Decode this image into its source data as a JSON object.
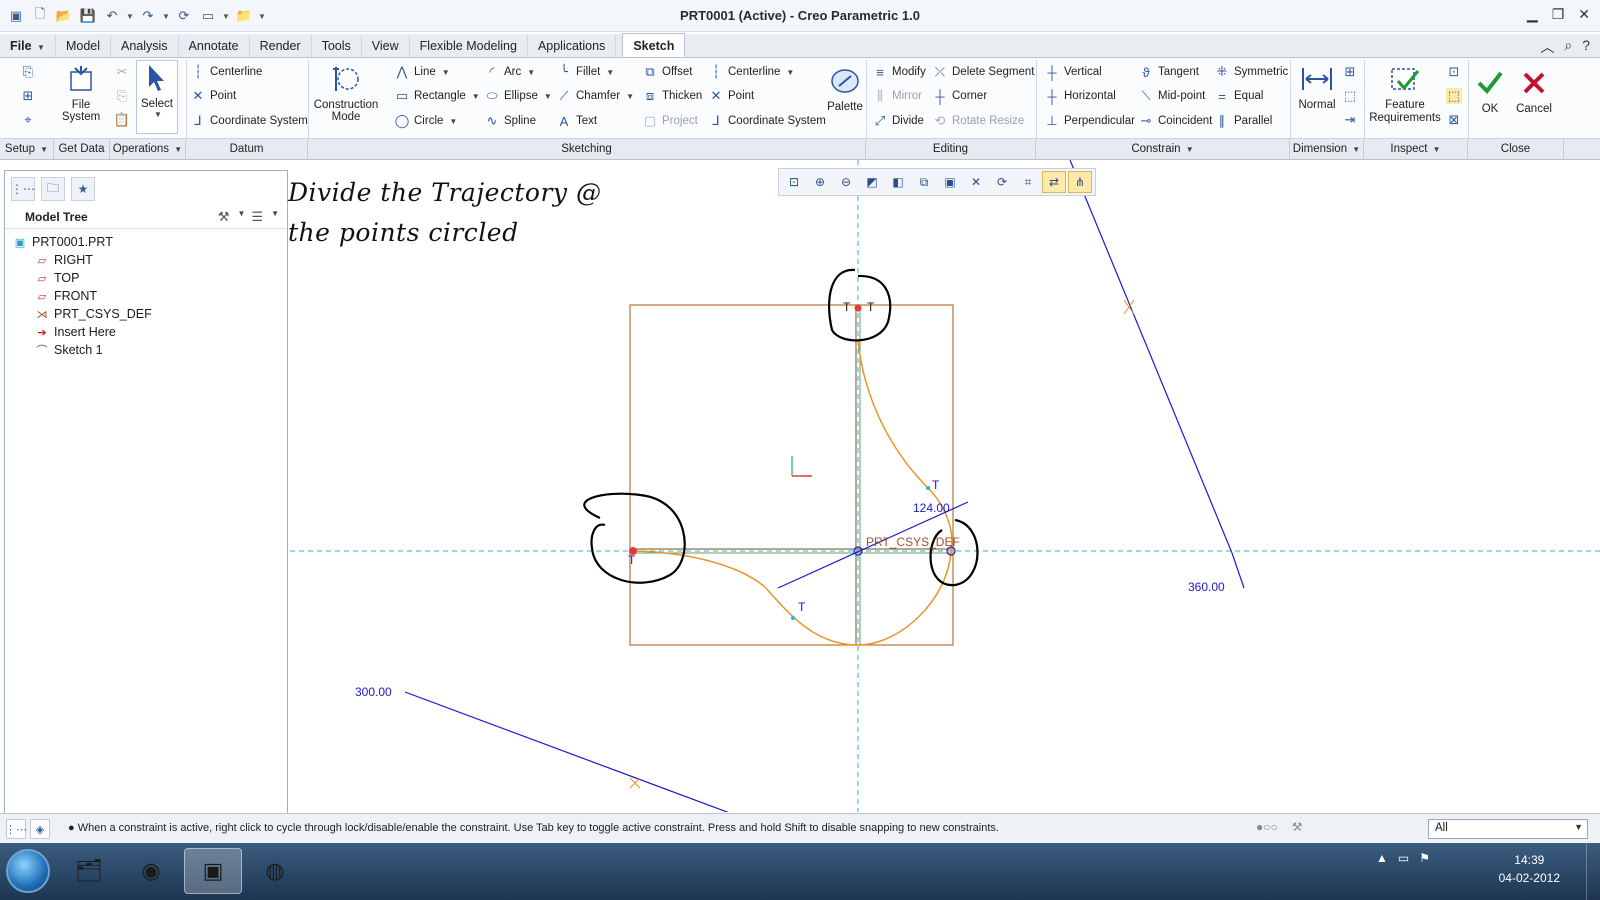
{
  "window": {
    "title": "PRT0001 (Active) - Creo Parametric 1.0"
  },
  "tabs": [
    {
      "label": "File"
    },
    {
      "label": "Model"
    },
    {
      "label": "Analysis"
    },
    {
      "label": "Annotate"
    },
    {
      "label": "Render"
    },
    {
      "label": "Tools"
    },
    {
      "label": "View"
    },
    {
      "label": "Flexible Modeling"
    },
    {
      "label": "Applications"
    },
    {
      "label": "Sketch",
      "active": true
    }
  ],
  "ribbon": {
    "setup": {
      "file_system": "File\nSystem",
      "select": "Select"
    },
    "datum": {
      "centerline": "Centerline",
      "point": "Point",
      "coordinate_system": "Coordinate System"
    },
    "construction_mode": "Construction\nMode",
    "sketching": {
      "line": "Line",
      "rectangle": "Rectangle",
      "circle": "Circle",
      "arc": "Arc",
      "ellipse": "Ellipse",
      "spline": "Spline",
      "fillet": "Fillet",
      "chamfer": "Chamfer",
      "text": "Text",
      "offset": "Offset",
      "thicken": "Thicken",
      "project": "Project",
      "centerline": "Centerline",
      "point": "Point",
      "coordinate_system": "Coordinate System",
      "palette": "Palette"
    },
    "editing": {
      "modify": "Modify",
      "mirror": "Mirror",
      "divide": "Divide",
      "delete_segment": "Delete Segment",
      "corner": "Corner",
      "rotate_resize": "Rotate Resize"
    },
    "constrain": {
      "vertical": "Vertical",
      "horizontal": "Horizontal",
      "perpendicular": "Perpendicular",
      "tangent": "Tangent",
      "mid_point": "Mid-point",
      "coincident": "Coincident",
      "symmetric": "Symmetric",
      "equal": "Equal",
      "parallel": "Parallel"
    },
    "dimension": {
      "normal": "Normal"
    },
    "inspect": {
      "feature_requirements": "Feature\nRequirements"
    },
    "close": {
      "ok": "OK",
      "cancel": "Cancel"
    },
    "groups": {
      "setup": "Setup",
      "get_data": "Get Data",
      "operations": "Operations",
      "datum": "Datum",
      "sketching": "Sketching",
      "editing": "Editing",
      "constrain": "Constrain",
      "dimension": "Dimension",
      "inspect": "Inspect",
      "close": "Close"
    }
  },
  "model_tree": {
    "title": "Model Tree",
    "root": "PRT0001.PRT",
    "items": [
      {
        "label": "RIGHT",
        "icon": "datum-plane-icon"
      },
      {
        "label": "TOP",
        "icon": "datum-plane-icon"
      },
      {
        "label": "FRONT",
        "icon": "datum-plane-icon"
      },
      {
        "label": "PRT_CSYS_DEF",
        "icon": "csys-icon"
      },
      {
        "label": "Insert Here",
        "icon": "insert-arrow-icon"
      },
      {
        "label": "Sketch 1",
        "icon": "sketch-icon"
      }
    ]
  },
  "canvas": {
    "annotation_line1": "Divide the Trajectory @",
    "annotation_line2": "the points circled",
    "dim_124": "124.00",
    "dim_360": "360.00",
    "dim_300": "300.00",
    "csys_label": "PRT_CSYS_DEF",
    "tangent_marker": "T",
    "colors": {
      "sketch": "#e8952a",
      "dimension": "#1a1ad0",
      "centerline": "#29b6d6",
      "rect": "#b87333",
      "annotation": "#000000"
    }
  },
  "status": {
    "message": "When a constraint is active, right click to cycle through lock/disable/enable the constraint. Use Tab key to toggle active constraint. Press and hold Shift to disable snapping to new constraints.",
    "filter": "All"
  },
  "taskbar": {
    "time": "14:39",
    "date": "04-02-2012"
  }
}
